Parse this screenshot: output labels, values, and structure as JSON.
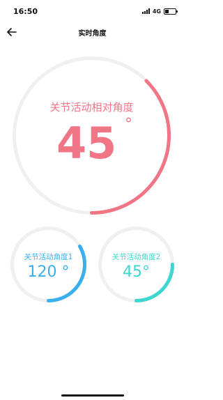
{
  "status": {
    "time": "16:50",
    "network": "4G",
    "battery_level": 0.35
  },
  "nav": {
    "title": "实时角度",
    "back_icon": "arrow-left-icon"
  },
  "main_gauge": {
    "label": "关节活动相对角度",
    "value": "45",
    "unit": "°",
    "fraction": 0.375,
    "color": "#f07686",
    "track_color": "#f0f0f0"
  },
  "sub_gauges": [
    {
      "label": "关节活动角度1",
      "value": "120",
      "unit": "°",
      "fraction": 0.3333,
      "color": "#3aaff0",
      "track_color": "#f0f0f0"
    },
    {
      "label": "关节活动角度2",
      "value": "45",
      "unit": "°",
      "fraction": 0.25,
      "color": "#3ed6d0",
      "track_color": "#f0f0f0"
    }
  ]
}
